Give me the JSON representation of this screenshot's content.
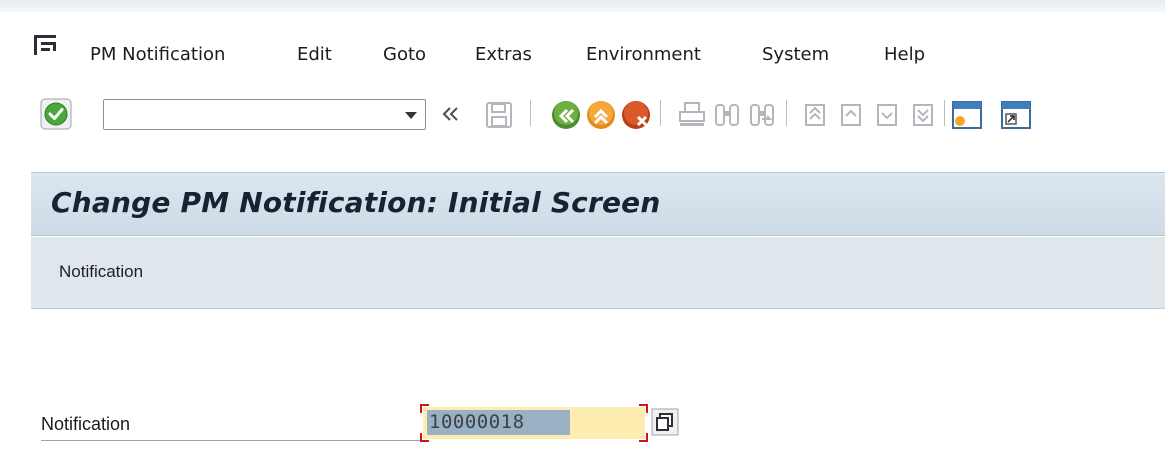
{
  "menu": {
    "items": [
      {
        "label": "PM Notification"
      },
      {
        "label": "Edit"
      },
      {
        "label": "Goto"
      },
      {
        "label": "Extras"
      },
      {
        "label": "Environment"
      },
      {
        "label": "System"
      },
      {
        "label": "Help"
      }
    ]
  },
  "toolbar": {
    "command_field_value": "",
    "icons": [
      "enter-icon",
      "dropdown-icon",
      "back-chevrons-icon",
      "save-icon",
      "back-icon",
      "exit-icon",
      "cancel-icon",
      "print-icon",
      "find-icon",
      "find-next-icon",
      "first-page-icon",
      "previous-page-icon",
      "next-page-icon",
      "last-page-icon",
      "create-session-icon",
      "shortcut-icon"
    ]
  },
  "title": "Change PM Notification: Initial Screen",
  "app_toolbar": {
    "notification_button": "Notification"
  },
  "form": {
    "notification_label": "Notification",
    "notification_value": "10000018"
  },
  "colors": {
    "title_bg": "#d3dee9",
    "input_bg": "#fdedb0",
    "selection": "#9ab0c4",
    "focus_corners": "#d1121b",
    "enter_green": "#4aa83a"
  }
}
